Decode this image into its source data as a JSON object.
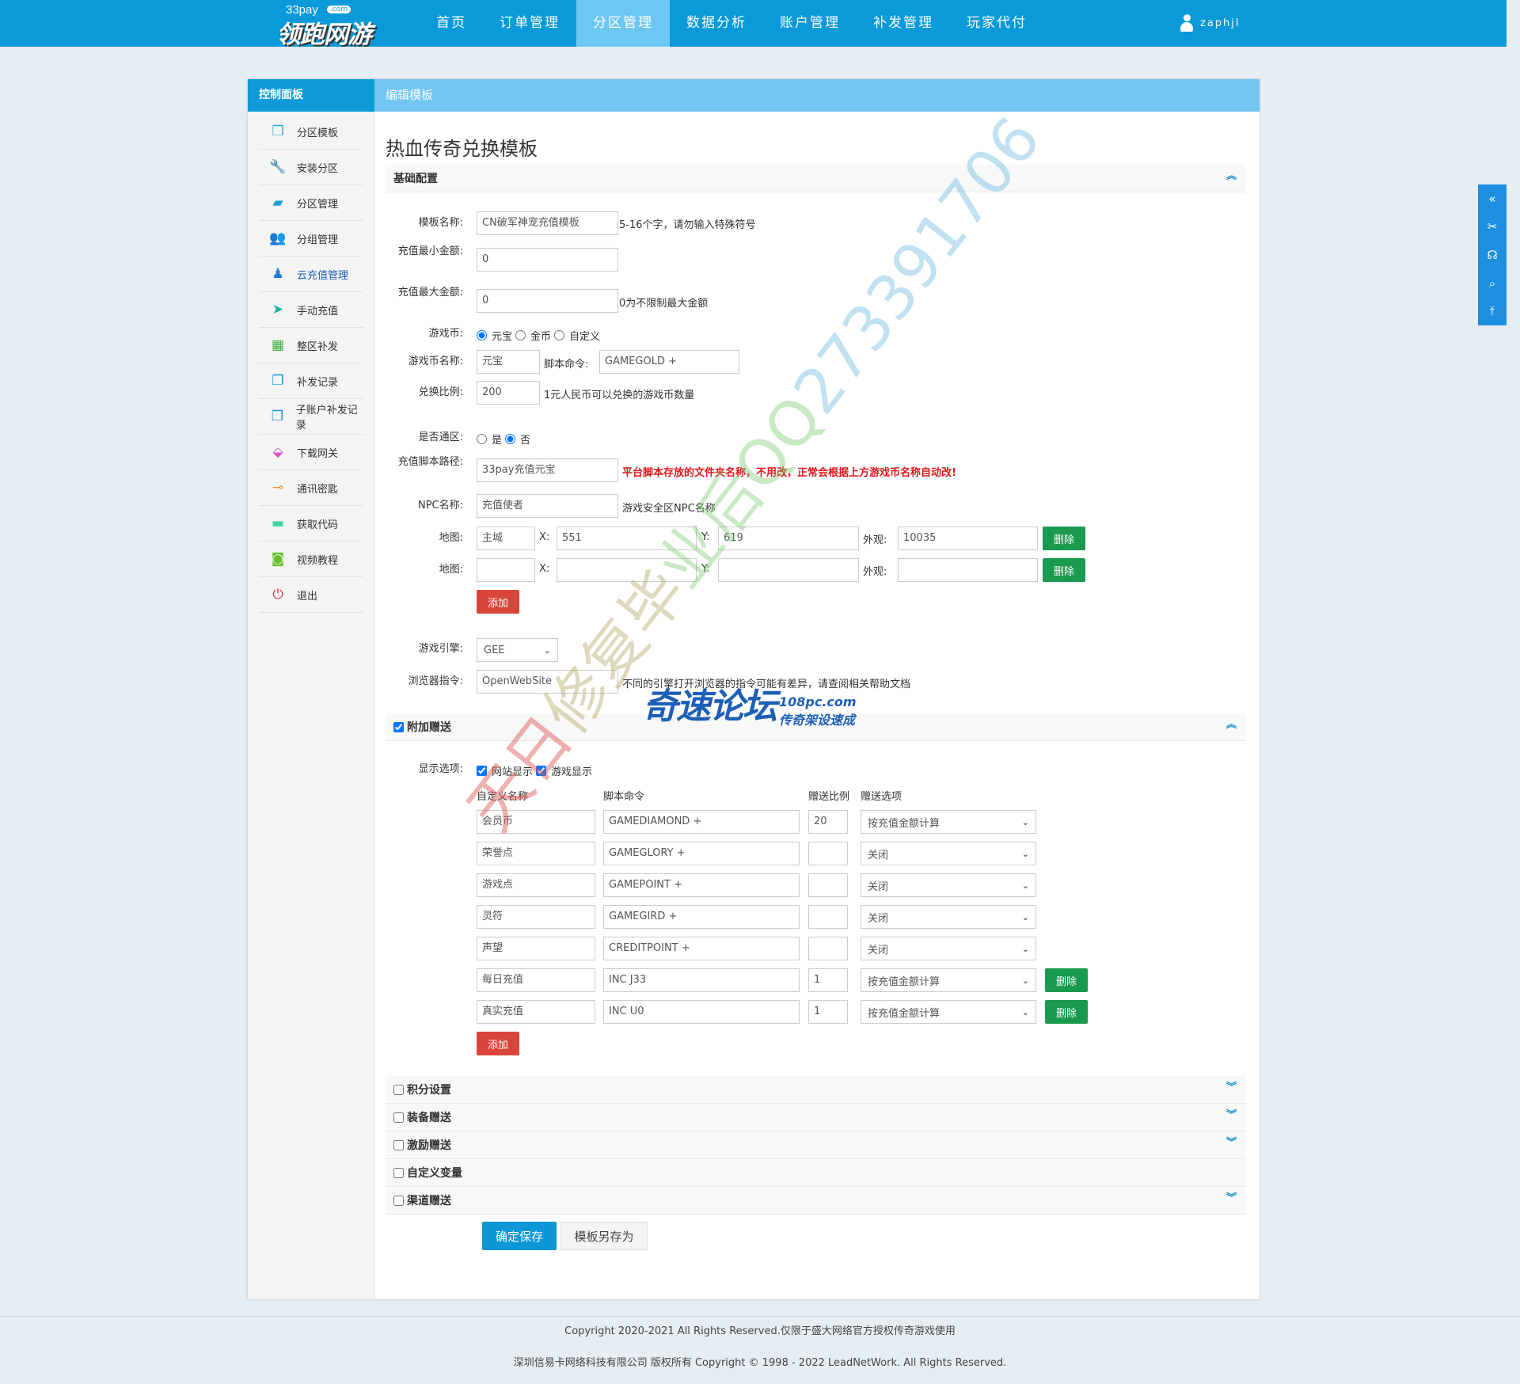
{
  "brand": {
    "small": "33pay",
    "com": ".com",
    "name": "领跑网游"
  },
  "nav": {
    "items": [
      {
        "label": "首页"
      },
      {
        "label": "订单管理"
      },
      {
        "label": "分区管理",
        "active": true
      },
      {
        "label": "数据分析"
      },
      {
        "label": "账户管理"
      },
      {
        "label": "补发管理"
      },
      {
        "label": "玩家代付"
      }
    ],
    "username": "zaphjl"
  },
  "sidebar": {
    "title": "控制面板",
    "items": [
      {
        "label": "分区模板",
        "icon": "copy-icon",
        "color": "#2fb0c8"
      },
      {
        "label": "安装分区",
        "icon": "wrench-icon",
        "color": "#5bb531"
      },
      {
        "label": "分区管理",
        "icon": "inbox-icon",
        "color": "#1e9fd4"
      },
      {
        "label": "分组管理",
        "icon": "users-icon",
        "color": "#49b749"
      },
      {
        "label": "云充值管理",
        "icon": "user-icon",
        "color": "#1f7fd0",
        "active": true
      },
      {
        "label": "手动充值",
        "icon": "paper-plane-icon",
        "color": "#25a8a0"
      },
      {
        "label": "整区补发",
        "icon": "calendar-icon",
        "color": "#3cab3c"
      },
      {
        "label": "补发记录",
        "icon": "copy-icon",
        "color": "#1e8fd2"
      },
      {
        "label": "子账户补发记录",
        "icon": "copy-icon",
        "color": "#1e8fd2"
      },
      {
        "label": "下载网关",
        "icon": "download-box-icon",
        "color": "#e04fc2"
      },
      {
        "label": "通讯密匙",
        "icon": "key-icon",
        "color": "#f09a2a"
      },
      {
        "label": "获取代码",
        "icon": "briefcase-icon",
        "color": "#3fd39a"
      },
      {
        "label": "视频教程",
        "icon": "video-icon",
        "color": "#6bbf2c"
      },
      {
        "label": "退出",
        "icon": "power-icon",
        "color": "#e23a3a"
      }
    ]
  },
  "header": {
    "breadcrumb": "编辑模板",
    "title": "热血传奇兑换模板"
  },
  "basic": {
    "section": "基础配置",
    "name_label": "模板名称:",
    "name_value": "CN破军神宠充值模板",
    "name_hint": "5-16个字，请勿输入特殊符号",
    "min_label": "充值最小金额:",
    "min_value": "0",
    "max_label": "充值最大金额:",
    "max_value": "0",
    "max_hint": "0为不限制最大金额",
    "currency_label": "游戏币:",
    "currency_options": [
      {
        "label": "元宝",
        "checked": true
      },
      {
        "label": "金币",
        "checked": false
      },
      {
        "label": "自定义",
        "checked": false
      }
    ],
    "currency_name_label": "游戏币名称:",
    "currency_name_value": "元宝",
    "script_label": "脚本命令:",
    "script_value": "GAMEGOLD +",
    "ratio_label": "兑换比例:",
    "ratio_value": "200",
    "ratio_hint": "1元人民币可以兑换的游戏币数量",
    "universal_label": "是否通区:",
    "universal_options": [
      {
        "label": "是",
        "checked": false
      },
      {
        "label": "否",
        "checked": true
      }
    ],
    "path_label": "充值脚本路径:",
    "path_value": "33pay充值元宝",
    "path_hint": "平台脚本存放的文件夹名称，不用改，正常会根据上方游戏币名称自动改!",
    "npc_label": "NPC名称:",
    "npc_value": "充值使者",
    "npc_hint": "游戏安全区NPC名称",
    "map_label": "地图:",
    "x_label": "X:",
    "y_label": "Y:",
    "look_label": "外观:",
    "maps": [
      {
        "map": "主城",
        "x": "551",
        "y": "619",
        "look": "10035"
      },
      {
        "map": "",
        "x": "",
        "y": "",
        "look": ""
      }
    ],
    "delete_label": "删除",
    "add_label": "添加",
    "engine_label": "游戏引擎:",
    "engine_value": "GEE",
    "browser_label": "浏览器指令:",
    "browser_value": "OpenWebSite",
    "browser_hint": "不同的引擎打开浏览器的指令可能有差异，请查阅相关帮助文档"
  },
  "extra": {
    "section": "附加赠送",
    "checked": true,
    "display_label": "显示选项:",
    "display_options": [
      {
        "label": "网站显示",
        "checked": true
      },
      {
        "label": "游戏显示",
        "checked": true
      }
    ],
    "columns": [
      "自定义名称",
      "脚本命令",
      "赠送比例",
      "赠送选项"
    ],
    "rows": [
      {
        "name": "会员币",
        "script": "GAMEDIAMOND +",
        "ratio": "20",
        "option": "按充值金额计算",
        "deletable": false
      },
      {
        "name": "荣誉点",
        "script": "GAMEGLORY +",
        "ratio": "",
        "option": "关闭",
        "deletable": false
      },
      {
        "name": "游戏点",
        "script": "GAMEPOINT +",
        "ratio": "",
        "option": "关闭",
        "deletable": false
      },
      {
        "name": "灵符",
        "script": "GAMEGIRD +",
        "ratio": "",
        "option": "关闭",
        "deletable": false
      },
      {
        "name": "声望",
        "script": "CREDITPOINT +",
        "ratio": "",
        "option": "关闭",
        "deletable": false
      },
      {
        "name": "每日充值",
        "script": "INC J33",
        "ratio": "1",
        "option": "按充值金额计算",
        "deletable": true
      },
      {
        "name": "真实充值",
        "script": "INC U0",
        "ratio": "1",
        "option": "按充值金额计算",
        "deletable": true
      }
    ],
    "delete_label": "删除",
    "add_label": "添加"
  },
  "collapsed_sections": [
    {
      "label": "积分设置",
      "checked": false,
      "expandable": true
    },
    {
      "label": "装备赠送",
      "checked": false,
      "expandable": true
    },
    {
      "label": "激励赠送",
      "checked": false,
      "expandable": true
    },
    {
      "label": "自定义变量",
      "checked": false,
      "expandable": false
    },
    {
      "label": "渠道赠送",
      "checked": false,
      "expandable": true
    }
  ],
  "actions": {
    "save": "确定保存",
    "save_as": "模板另存为"
  },
  "float_toolbar": [
    "collapse-icon",
    "tools-icon",
    "headset-icon",
    "search-icon",
    "back-to-top-icon"
  ],
  "footer": {
    "line1": "Copyright 2020-2021 All Rights Reserved.仅限于盛大网络官方授权传奇游戏使用",
    "line2": "深圳信易卡网络科技有限公司 版权所有 Copyright © 1998 - 2022 LeadNetWork. All Rights Reserved."
  },
  "watermarks": {
    "diagonal": "天日修复毕业后QQ273391706",
    "logo_main": "奇速论坛",
    "logo_url": "108pc.com",
    "logo_sub": "传奇架设速成"
  },
  "colors": {
    "topbar": "#0a99d9",
    "active_tab": "#6dc7f3",
    "danger": "#d9453a",
    "success": "#1a9a4f",
    "primary": "#0e97d6"
  }
}
